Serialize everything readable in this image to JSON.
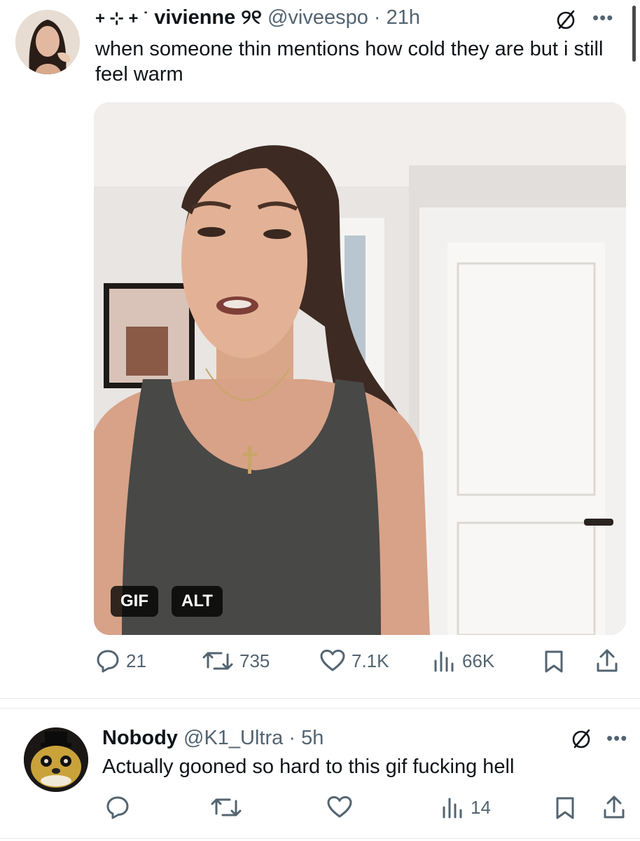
{
  "tweet1": {
    "display_name_prefix": "+ ⊹ + ˙",
    "display_name": "vivienne ୨୧",
    "handle": "@viveespo",
    "separator": "·",
    "time": "21h",
    "text": "when someone thin mentions how cold they are but i still feel warm",
    "media_badges": {
      "gif": "GIF",
      "alt": "ALT"
    },
    "actions": {
      "replies": "21",
      "reposts": "735",
      "likes": "7.1K",
      "views": "66K"
    }
  },
  "tweet2": {
    "display_name": "Nobody",
    "handle": "@K1_Ultra",
    "separator": "·",
    "time": "5h",
    "text": "Actually gooned so hard to this gif fucking hell",
    "actions": {
      "views": "14"
    }
  },
  "colors": {
    "text": "#0f1419",
    "muted": "#536471",
    "divider": "#e7e9ea",
    "background": "#ffffff"
  },
  "icons": [
    "grok-icon",
    "more-icon",
    "reply-icon",
    "repost-icon",
    "like-icon",
    "views-icon",
    "bookmark-icon",
    "share-icon"
  ]
}
